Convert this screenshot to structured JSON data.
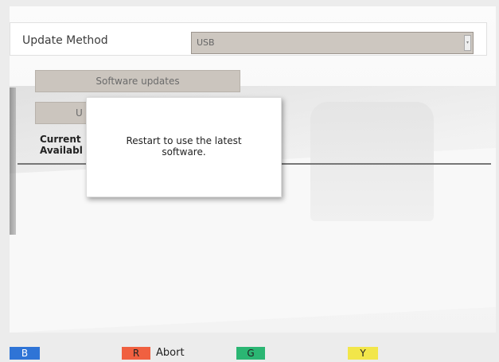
{
  "update_method": {
    "label": "Update Method",
    "selected_value": "USB"
  },
  "buttons": {
    "software_updates": "Software updates",
    "hidden_button_partial": "U"
  },
  "info": {
    "current_partial": "Current",
    "available_partial": "Availabl"
  },
  "dialog": {
    "message_line1": "Restart to use the latest",
    "message_line2": "software."
  },
  "footer": {
    "blue_key": "B",
    "red_key": "R",
    "red_action": "Abort",
    "green_key": "G",
    "yellow_key": "Y"
  },
  "colors": {
    "blue": "#2f74d6",
    "red": "#f06040",
    "green": "#2bb673",
    "yellow": "#f2e64a"
  }
}
